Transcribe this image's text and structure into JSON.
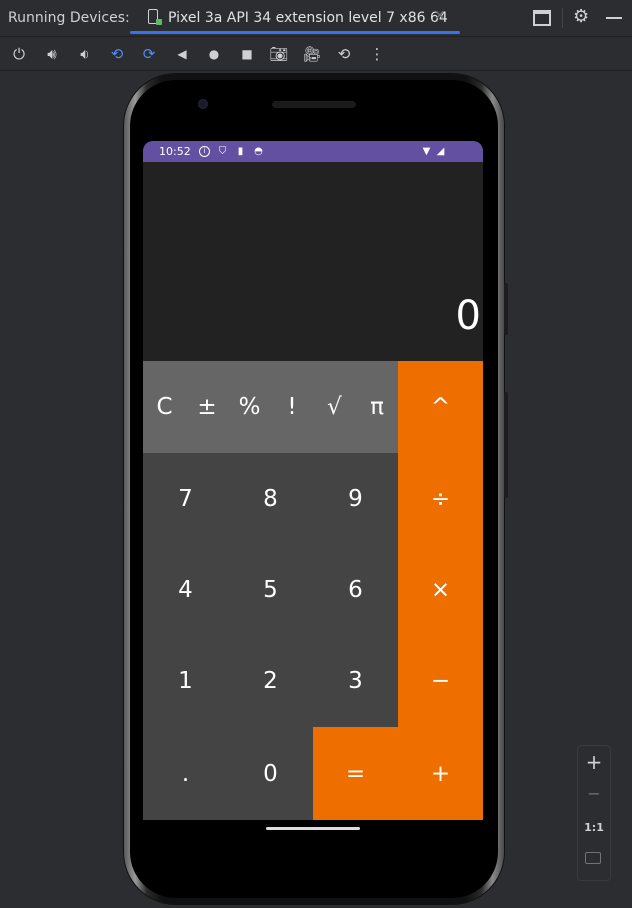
{
  "ide": {
    "panel_title": "Running Devices:",
    "tab_label": "Pixel 3a API 34 extension level 7 x86 64",
    "tab_close": "✕",
    "colors": {
      "accent": "#3574f0",
      "background": "#2b2d30"
    }
  },
  "toolbar": {
    "icons": [
      "power-icon",
      "volume-up-icon",
      "volume-down-icon",
      "rotate-left-icon",
      "rotate-right-icon",
      "back-icon",
      "home-icon",
      "overview-icon",
      "screenshot-icon",
      "screen-record-icon",
      "snapshot-icon",
      "more-icon"
    ]
  },
  "zoom": {
    "plus": "+",
    "minus": "−",
    "one_to_one": "1:1"
  },
  "device": {
    "status_time": "10:52",
    "colors": {
      "status_bar": "#6450a0",
      "operator": "#ee6e00",
      "number": "#444444",
      "scientific": "#666666"
    }
  },
  "calculator": {
    "display": "0",
    "scientific": [
      "C",
      "±",
      "%",
      "!",
      "√",
      "π"
    ],
    "operators": [
      "^",
      "÷",
      "×",
      "−",
      "+"
    ],
    "digits": [
      "7",
      "8",
      "9",
      "4",
      "5",
      "6",
      "1",
      "2",
      "3"
    ],
    "decimal": ".",
    "zero": "0",
    "equals": "="
  }
}
